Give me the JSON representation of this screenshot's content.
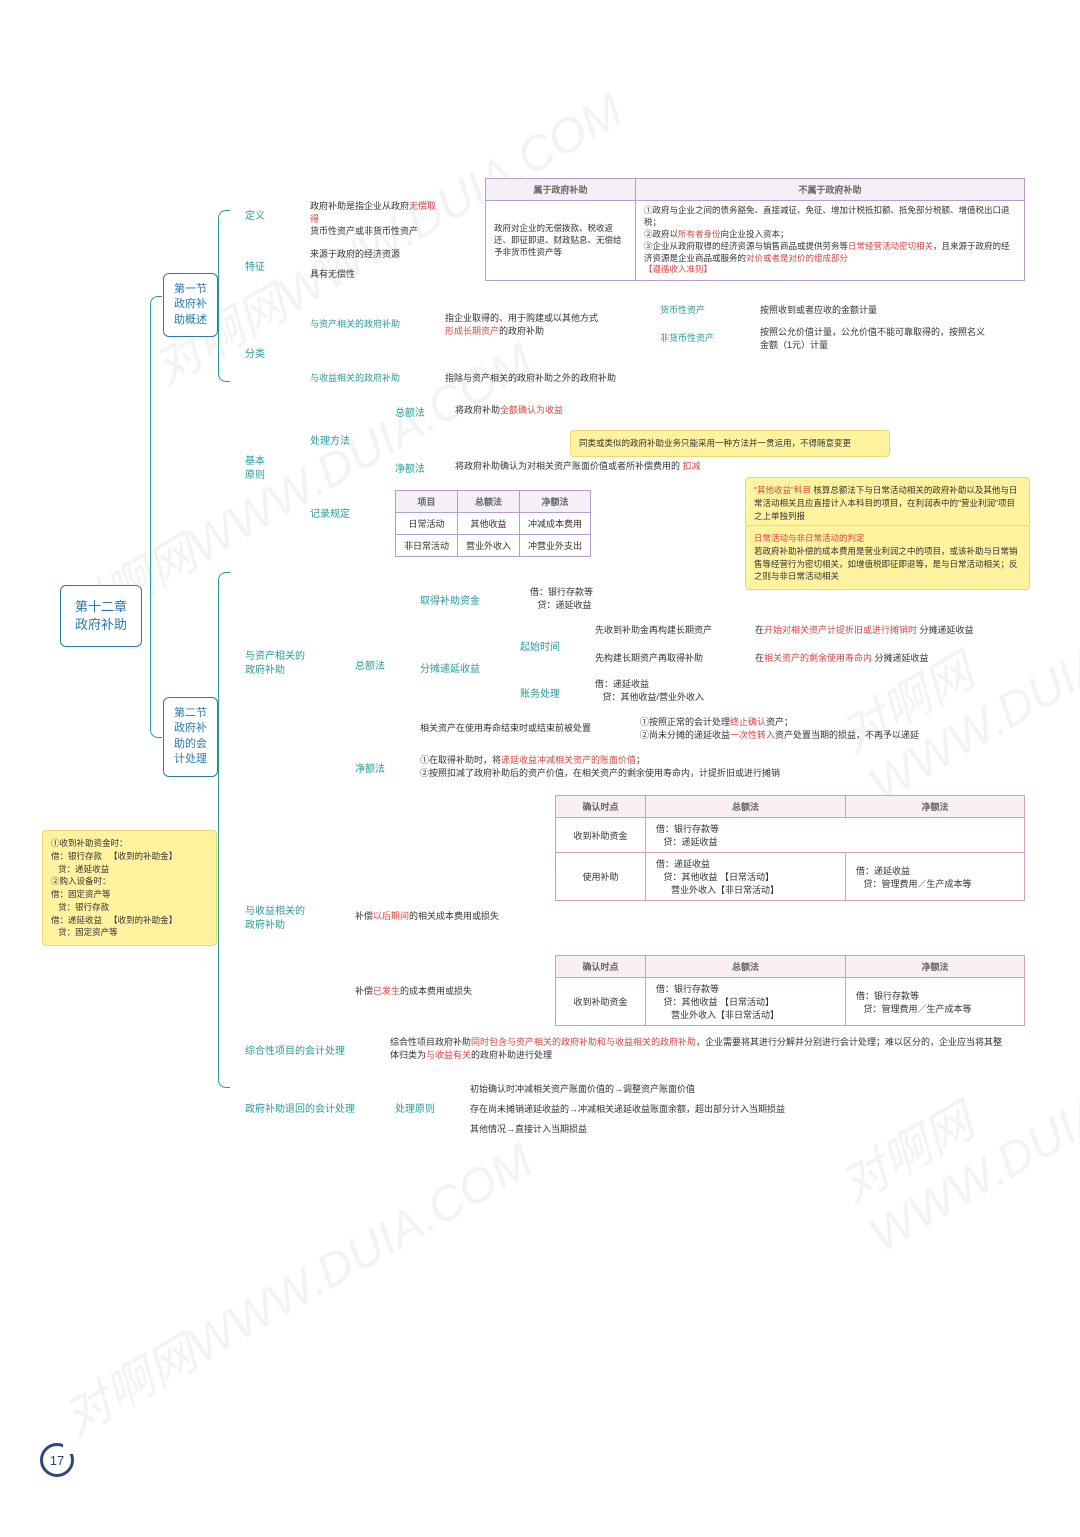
{
  "watermark": "对啊网WWW.DUIA.COM",
  "root": "第十二章\n政府补助",
  "sections": {
    "s1": "第一节\n政府补\n助概述",
    "s2": "第二节\n政府补\n助的会\n计处理"
  },
  "defs": {
    "def": "定义",
    "def_txt": "政府补助是指企业从政府",
    "def_red": "无偿取得",
    "def_txt2": "货币性资产或非货币性资产",
    "feat": "特征",
    "feat1": "来源于政府的经济资源",
    "feat2": "具有无偿性",
    "cls": "分类",
    "cls1": "与资产相关的政府补助",
    "cls1_txt": "指企业取得的、用于购建或以其他方式",
    "cls1_red": "形成长期资产",
    "cls1_txt2": "的政府补助",
    "cls2": "与收益相关的政府补助",
    "cls2_txt": "指除与资产相关的政府补助之外的政府补助",
    "mon": "货币性资产",
    "mon_txt": "按照收到或者应收的金额计量",
    "nonmon": "非货币性资产",
    "nonmon_txt": "按照公允价值计量，公允价值不能可靠取得的，按照名义金额（1元）计量"
  },
  "scope": {
    "belong": "属于政府补助",
    "not_belong": "不属于政府补助",
    "b_txt": "政府对企业的无偿拨款、税收返还、即征即退、财政贴息、无偿给予非货币性资产等",
    "nb1": "①政府与企业之间的债务豁免、直接减征、免征、增加计税抵扣额、抵免部分税额、增值税出口退税；",
    "nb2": "②政府以",
    "nb2_red": "所有者身份",
    "nb2_2": "向企业投入资本；",
    "nb3": "③企业从政府取得的经济资源与销售商品或提供劳务等",
    "nb3_red": "日常经营活动密切相关",
    "nb3_2": "，且来源于政府的经济资源是企业商品或服务的",
    "nb3_red2": "对价或者是对价的组成部分",
    "nb3_3": "【遵循收入准则】"
  },
  "basic": {
    "title": "基本\n原则",
    "method": "处理方法",
    "gross": "总额法",
    "gross_txt": "将政府补助",
    "gross_red": "全额确认为收益",
    "net": "净额法",
    "net_txt": "将政府补助确认为对相关资产账面价值或者所补偿费用的",
    "net_red": "扣减",
    "yellow1": "同类或类似的政府补助业务只能采用一种方法并一贯运用，不得随意变更",
    "record": "记录规定",
    "proj": "项目",
    "daily": "日常活动",
    "nondaily": "非日常活动",
    "other_inc": "其他收益",
    "op_out": "营业外收入",
    "ded_cost": "冲减成本费用",
    "ded_op": "冲营业外支出",
    "yellow2_1": "\"其他收益\"科目",
    "yellow2_2": "核算总额法下与日常活动相关的政府补助以及其他与日常活动相关且应直接计入本科目的项目，在利润表中的\"营业利润\"项目之上单独列报",
    "yellow3_1": "日常活动与非日常活动的判定",
    "yellow3_2": "若政府补助补偿的成本费用是营业利润之中的项目，或该补助与日常销售等经营行为密切相关，如增值税即征即退等，是与日常活动相关；反之则与非日常活动相关"
  },
  "asset": {
    "title": "与资产相关的\n政府补助",
    "gross": "总额法",
    "get": "取得补助资金",
    "get_dr": "借：银行存款等",
    "get_cr": "贷：递延收益",
    "amort": "分摊递延收益",
    "start": "起始时间",
    "s1": "先收到补助金再构建长期资产",
    "s1_r": "在",
    "s1_red": "开始对相关资产计提折旧或进行摊销时",
    "s1_r2": "分摊递延收益",
    "s2": "先构建长期资产再取得补助",
    "s2_r": "在",
    "s2_red": "相关资产的剩余使用寿命内",
    "s2_r2": "分摊递延收益",
    "acct": "账务处理",
    "acct_dr": "借：递延收益",
    "acct_cr": "贷：其他收益/营业外收入",
    "disposal": "相关资产在使用寿命结束时或结束前被处置",
    "disp1": "①按照正常的会计处理",
    "disp1_red": "终止确认",
    "disp1_2": "资产；",
    "disp2": "②尚未分摊的递延收益",
    "disp2_red": "一次性转入",
    "disp2_2": "资产处置当期的损益，不再予以递延",
    "net": "净额法",
    "net1": "①在取得补助时，将",
    "net1_red": "递延收益冲减相关资产的账面价值",
    "net1_2": "；",
    "net2": "②按照扣减了政府补助后的资产价值，在相关资产的剩余使用寿命内，计提折旧或进行摊销"
  },
  "income": {
    "title": "与收益相关的\n政府补助",
    "future": "补偿",
    "future_red": "以后期间",
    "future_2": "的相关成本费用或损失",
    "past": "补偿",
    "past_red": "已发生",
    "past_2": "的成本费用或损失",
    "confirm": "确认时点",
    "recv": "收到补助资金",
    "use": "使用补助",
    "t1_dr": "借：银行存款等",
    "t1_cr": "贷：递延收益",
    "t2_dr": "借：递延收益",
    "t2_cr1": "贷：其他收益 【日常活动】",
    "t2_cr2": "营业外收入【非日常活动】",
    "t2n_dr": "借：递延收益",
    "t2n_cr": "贷：管理费用／生产成本等",
    "t3_dr": "借：银行存款等",
    "t3_cr1": "贷：其他收益 【日常活动】",
    "t3_cr2": "营业外收入【非日常活动】",
    "t3n_dr": "借：银行存款等",
    "t3n_cr": "贷：管理费用／生产成本等"
  },
  "yellow_left": {
    "l1": "①收到补助资金时：",
    "l2": "借：银行存款",
    "l2b": "【收到的补助金】",
    "l3": "贷：递延收益",
    "l4": "②购入设备时：",
    "l5": "借：固定资产等",
    "l6": "贷：银行存款",
    "l7": "借：递延收益",
    "l7b": "【收到的补助金】",
    "l8": "贷：固定资产等"
  },
  "composite": {
    "title": "综合性项目的会计处理",
    "txt1": "综合性项目政府补助",
    "red1": "同时包含与资产相关的政府补助和与收益相关的政府补助",
    "txt2": "，企业需要将其进行分解并分别进行会计处理；难以区分的，企业应当将其整体归类为",
    "red2": "与收益有关",
    "txt3": "的政府补助进行处理"
  },
  "refund": {
    "title": "政府补助退回的会计处理",
    "principle": "处理原则",
    "r1": "初始确认时冲减相关资产账面价值的→调整资产账面价值",
    "r2": "存在尚未摊销递延收益的→冲减相关递延收益账面余额，超出部分计入当期损益",
    "r3": "其他情况→直接计入当期损益"
  },
  "page": "17"
}
